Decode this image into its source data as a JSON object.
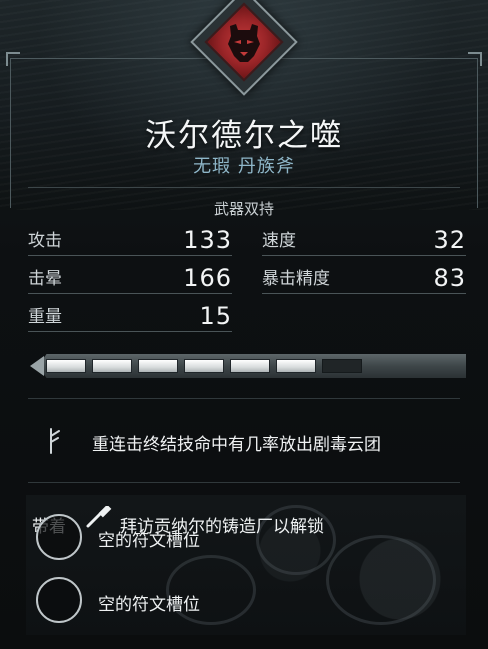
{
  "emblem": {
    "icon": "bear-head-icon",
    "color": "#b32e31"
  },
  "item": {
    "name": "沃尔德尔之噬",
    "subtitle": "无瑕 丹族斧",
    "wield": "武器双持"
  },
  "stats": [
    {
      "label": "攻击",
      "value": "133"
    },
    {
      "label": "速度",
      "value": "32"
    },
    {
      "label": "击晕",
      "value": "166"
    },
    {
      "label": "暴击精度",
      "value": "83"
    },
    {
      "label": "重量",
      "value": "15"
    }
  ],
  "upgrade": {
    "filled": 6,
    "total": 7
  },
  "perk": {
    "icon": "rune-glyph-icon",
    "text": "重连击终结技命中有几率放出剧毒云团"
  },
  "runes": {
    "bring_label": "带着",
    "lock_icon": "hammer-icon",
    "unlock_text": "拜访贡纳尔的铸造厂以解锁",
    "slots": [
      {
        "label": "空的符文槽位"
      },
      {
        "label": "空的符文槽位"
      }
    ]
  }
}
